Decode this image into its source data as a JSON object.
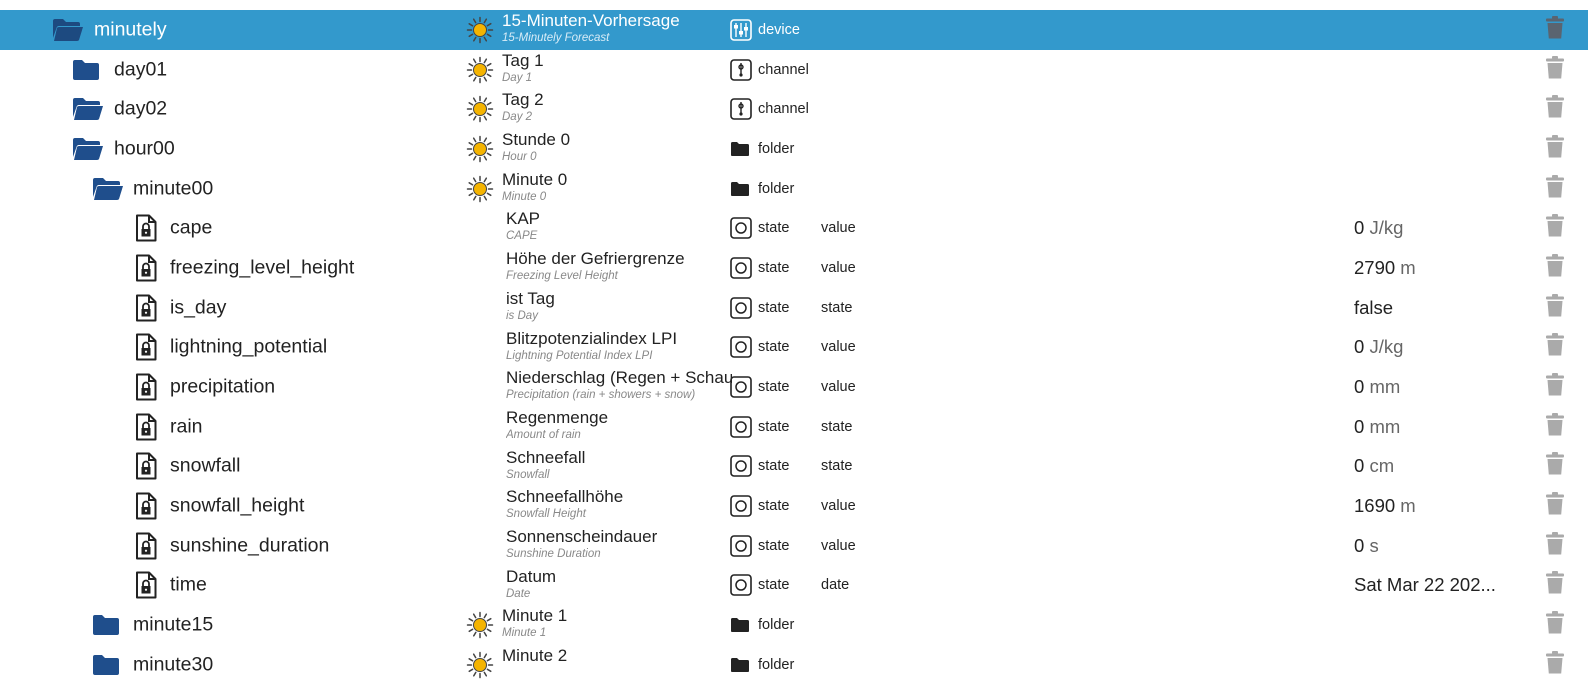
{
  "rows": [
    {
      "depth": 0,
      "icon": "folder-open-icon",
      "id": "minutely",
      "selected": true,
      "has_sun": true,
      "name": "15-Minuten-Vorhersage",
      "name_en": "15-Minutely Forecast",
      "type_icon": "device-icon",
      "type": "device",
      "role": "",
      "value": "",
      "unit": ""
    },
    {
      "depth": 1,
      "icon": "folder-closed-icon",
      "id": "day01",
      "has_sun": true,
      "name": "Tag 1",
      "name_en": "Day 1",
      "type_icon": "channel-icon",
      "type": "channel",
      "role": "",
      "value": "",
      "unit": ""
    },
    {
      "depth": 1,
      "icon": "folder-open-icon",
      "id": "day02",
      "has_sun": true,
      "name": "Tag 2",
      "name_en": "Day 2",
      "type_icon": "channel-icon",
      "type": "channel",
      "role": "",
      "value": "",
      "unit": ""
    },
    {
      "depth": 2,
      "icon": "folder-open-icon",
      "id": "hour00",
      "has_sun": true,
      "name": "Stunde 0",
      "name_en": "Hour 0",
      "type_icon": "folder-icon",
      "type": "folder",
      "role": "",
      "value": "",
      "unit": ""
    },
    {
      "depth": 3,
      "icon": "folder-open-icon",
      "id": "minute00",
      "has_sun": true,
      "name": "Minute 0",
      "name_en": "Minute 0",
      "type_icon": "folder-icon",
      "type": "folder",
      "role": "",
      "value": "",
      "unit": ""
    },
    {
      "depth": 4,
      "icon": "state-file-icon",
      "id": "cape",
      "has_sun": false,
      "name": "KAP",
      "name_en": "CAPE",
      "type_icon": "state-icon",
      "type": "state",
      "role": "value",
      "value": "0",
      "unit": "J/kg"
    },
    {
      "depth": 4,
      "icon": "state-file-icon",
      "id": "freezing_level_height",
      "has_sun": false,
      "name": "Höhe der Gefriergrenze",
      "name_en": "Freezing Level Height",
      "type_icon": "state-icon",
      "type": "state",
      "role": "value",
      "value": "2790",
      "unit": "m"
    },
    {
      "depth": 4,
      "icon": "state-file-icon",
      "id": "is_day",
      "has_sun": false,
      "name": "ist Tag",
      "name_en": "is Day",
      "type_icon": "state-icon",
      "type": "state",
      "role": "state",
      "value": "false",
      "unit": ""
    },
    {
      "depth": 4,
      "icon": "state-file-icon",
      "id": "lightning_potential",
      "has_sun": false,
      "name": "Blitzpotenzialindex LPI",
      "name_en": "Lightning Potential Index LPI",
      "type_icon": "state-icon",
      "type": "state",
      "role": "value",
      "value": "0",
      "unit": "J/kg"
    },
    {
      "depth": 4,
      "icon": "state-file-icon",
      "id": "precipitation",
      "has_sun": false,
      "name": "Niederschlag (Regen + Schauer + Schnee)",
      "name_en": "Precipitation (rain + showers + snow)",
      "type_icon": "state-icon",
      "type": "state",
      "role": "value",
      "value": "0",
      "unit": "mm"
    },
    {
      "depth": 4,
      "icon": "state-file-icon",
      "id": "rain",
      "has_sun": false,
      "name": "Regenmenge",
      "name_en": "Amount of rain",
      "type_icon": "state-icon",
      "type": "state",
      "role": "state",
      "value": "0",
      "unit": "mm"
    },
    {
      "depth": 4,
      "icon": "state-file-icon",
      "id": "snowfall",
      "has_sun": false,
      "name": "Schneefall",
      "name_en": "Snowfall",
      "type_icon": "state-icon",
      "type": "state",
      "role": "state",
      "value": "0",
      "unit": "cm"
    },
    {
      "depth": 4,
      "icon": "state-file-icon",
      "id": "snowfall_height",
      "has_sun": false,
      "name": "Schneefallhöhe",
      "name_en": "Snowfall Height",
      "type_icon": "state-icon",
      "type": "state",
      "role": "value",
      "value": "1690",
      "unit": "m"
    },
    {
      "depth": 4,
      "icon": "state-file-icon",
      "id": "sunshine_duration",
      "has_sun": false,
      "name": "Sonnenscheindauer",
      "name_en": "Sunshine Duration",
      "type_icon": "state-icon",
      "type": "state",
      "role": "value",
      "value": "0",
      "unit": "s"
    },
    {
      "depth": 4,
      "icon": "state-file-icon",
      "id": "time",
      "has_sun": false,
      "name": "Datum",
      "name_en": "Date",
      "type_icon": "state-icon",
      "type": "state",
      "role": "date",
      "value": "Sat Mar 22 202...",
      "unit": ""
    },
    {
      "depth": 3,
      "icon": "folder-closed-icon",
      "id": "minute15",
      "has_sun": true,
      "name": "Minute 1",
      "name_en": "Minute 1",
      "type_icon": "folder-icon",
      "type": "folder",
      "role": "",
      "value": "",
      "unit": ""
    },
    {
      "depth": 3,
      "icon": "folder-closed-icon",
      "id": "minute30",
      "has_sun": true,
      "name": "Minute 2",
      "name_en": "",
      "type_icon": "folder-icon",
      "type": "folder",
      "role": "",
      "value": "",
      "unit": ""
    }
  ],
  "colors": {
    "selected_bg": "#3399cc",
    "folder": "#1f4e8c",
    "sun": "#f5b400",
    "trash": "#aaaaaa"
  }
}
